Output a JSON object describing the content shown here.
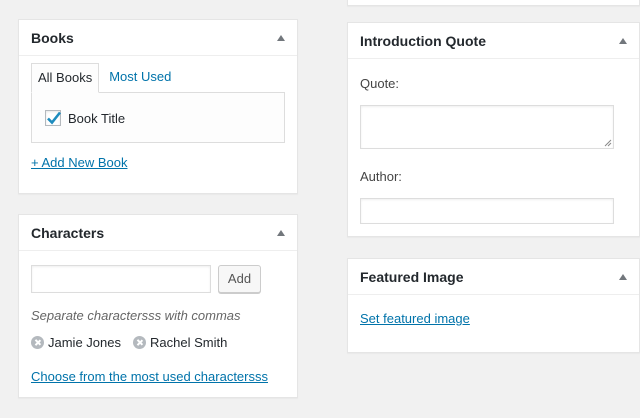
{
  "books": {
    "title": "Books",
    "tabs": [
      {
        "label": "All Books",
        "active": true
      },
      {
        "label": "Most Used",
        "active": false
      }
    ],
    "items": [
      {
        "label": "Book Title",
        "checked": true
      }
    ],
    "add_new_label": "+ Add New Book"
  },
  "characters": {
    "title": "Characters",
    "input_value": "",
    "add_button_label": "Add",
    "help_text": "Separate charactersss with commas",
    "tags": [
      {
        "label": "Jamie Jones"
      },
      {
        "label": "Rachel Smith"
      }
    ],
    "choose_link": "Choose from the most used charactersss"
  },
  "intro_quote": {
    "title": "Introduction Quote",
    "quote_label": "Quote:",
    "quote_value": "",
    "author_label": "Author:",
    "author_value": ""
  },
  "featured_image": {
    "title": "Featured Image",
    "set_link": "Set featured image"
  },
  "colors": {
    "background": "#f1f1f1",
    "panel": "#ffffff",
    "link": "#0073aa",
    "checkmark": "#1e8cbe",
    "border": "#e5e5e5"
  }
}
